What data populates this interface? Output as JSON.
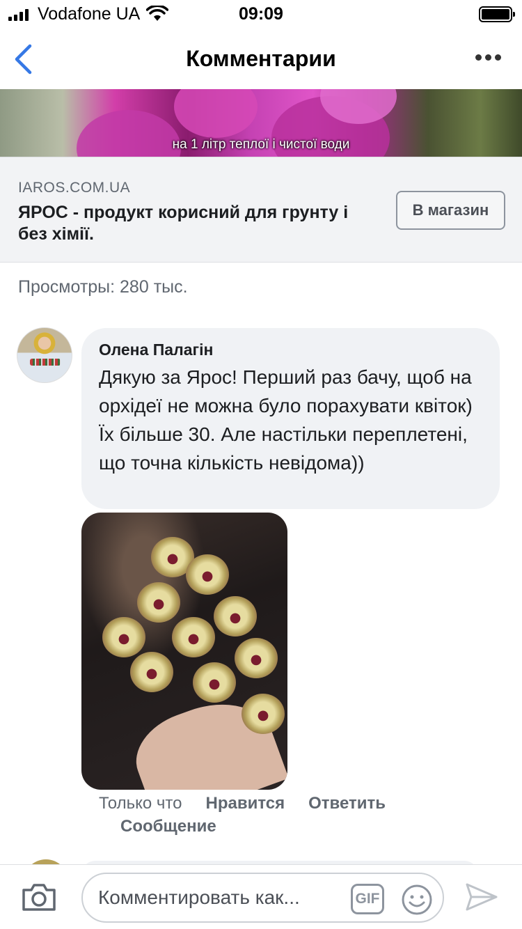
{
  "status_bar": {
    "carrier": "Vodafone UA",
    "time": "09:09"
  },
  "nav": {
    "title": "Комментарии",
    "back_icon": "chevron-left-icon",
    "more_icon": "ellipsis-icon"
  },
  "video": {
    "caption": "на 1 літр теплої і чистої води"
  },
  "link_card": {
    "domain": "IAROS.COM.UA",
    "title": "ЯРОС - продукт корисний для грунту і без хімії.",
    "button_label": "В магазин"
  },
  "views": "Просмотры: 280 тыс.",
  "comment": {
    "author": "Олена Палагін",
    "text": "Дякую за Ярос! Перший раз  бачу, щоб на орхідеї не можна було порахувати квіток) Їх більше 30. Але настільки переплетені, що точна кількість невідома))",
    "time": "Только что",
    "like_label": "Нравится",
    "reply_label": "Ответить",
    "message_label": "Сообщение"
  },
  "composer": {
    "placeholder": "Комментировать как...",
    "gif_label": "GIF",
    "camera_icon": "camera-icon",
    "emoji_icon": "smiley-icon",
    "send_icon": "send-icon"
  },
  "colors": {
    "accent_blue": "#3578e5",
    "bubble_bg": "#f0f2f5",
    "secondary_text": "#606770"
  }
}
